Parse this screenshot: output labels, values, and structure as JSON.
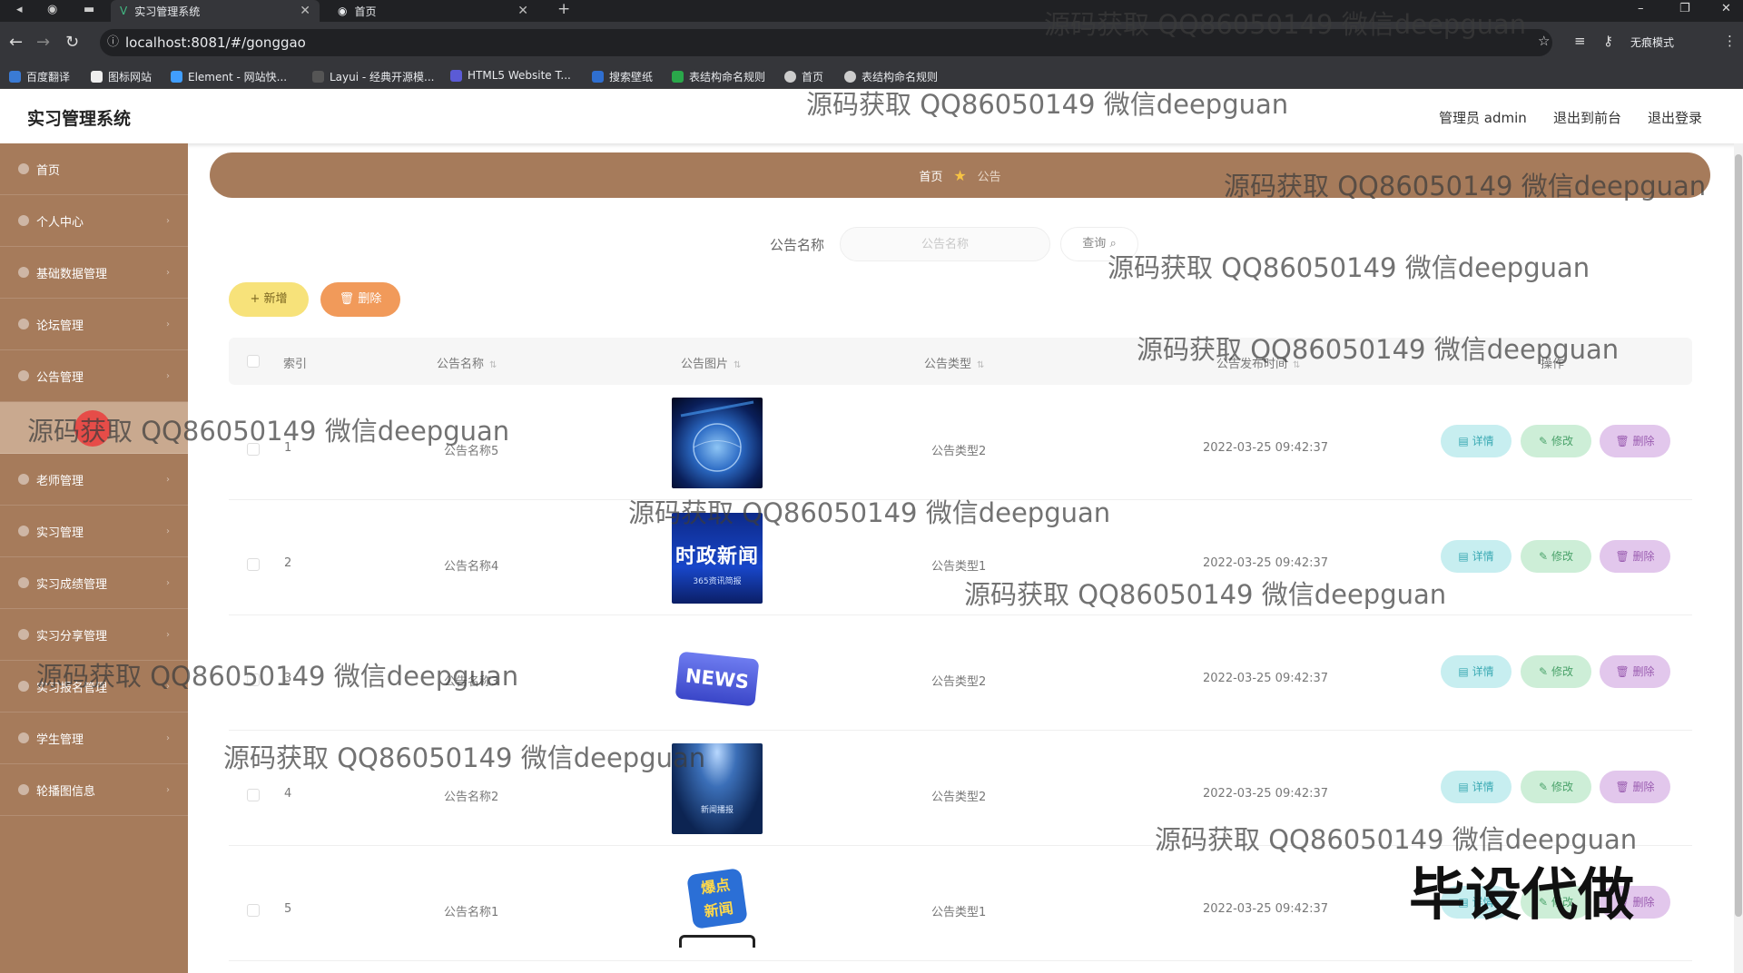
{
  "browser": {
    "tabs": [
      {
        "title": "实习管理系统"
      },
      {
        "title": "首页"
      }
    ],
    "new_tab": "+",
    "url": "localhost:8081/#/gonggao",
    "profile": "无痕模式",
    "bookmarks": [
      "百度翻译",
      "图标网站",
      "Element - 网站快...",
      "Layui - 经典开源模...",
      "HTML5 Website T...",
      "搜索壁纸",
      "表结构命名规则",
      "首页",
      "表结构命名规则"
    ]
  },
  "app": {
    "title": "实习管理系统",
    "user": "管理员 admin",
    "to_front": "退出到前台",
    "logout": "退出登录"
  },
  "sidebar": {
    "items": [
      {
        "label": "首页"
      },
      {
        "label": "个人中心"
      },
      {
        "label": "基础数据管理"
      },
      {
        "label": "论坛管理"
      },
      {
        "label": "公告管理"
      },
      {
        "label": ""
      },
      {
        "label": "老师管理"
      },
      {
        "label": "实习管理"
      },
      {
        "label": "实习成绩管理"
      },
      {
        "label": "实习分享管理"
      },
      {
        "label": "实习报名管理"
      },
      {
        "label": "学生管理"
      },
      {
        "label": "轮播图信息"
      }
    ]
  },
  "breadcrumb": {
    "home": "首页",
    "current": "公告"
  },
  "search": {
    "label": "公告名称",
    "placeholder": "公告名称",
    "button": "查询"
  },
  "toolbar": {
    "add": "+ 新增",
    "delete": "删除"
  },
  "table": {
    "headers": {
      "index": "索引",
      "name": "公告名称",
      "image": "公告图片",
      "type": "公告类型",
      "time": "公告发布时间",
      "ops": "操作"
    },
    "actions": {
      "detail": "详情",
      "edit": "修改",
      "remove": "删除"
    },
    "rows": [
      {
        "index": "1",
        "name": "公告名称5",
        "image": "globe-news-image",
        "type": "公告类型2",
        "time": "2022-03-25 09:42:37"
      },
      {
        "index": "2",
        "name": "公告名称4",
        "image": "shizheng-news-image",
        "type": "公告类型1",
        "time": "2022-03-25 09:42:37"
      },
      {
        "index": "3",
        "name": "公告名称3",
        "image": "news-button-image",
        "type": "公告类型2",
        "time": "2022-03-25 09:42:37"
      },
      {
        "index": "4",
        "name": "公告名称2",
        "image": "stage-news-image",
        "type": "公告类型2",
        "time": "2022-03-25 09:42:37"
      },
      {
        "index": "5",
        "name": "公告名称1",
        "image": "baodian-news-image",
        "type": "公告类型1",
        "time": "2022-03-25 09:42:37"
      }
    ]
  },
  "images": {
    "row2_line1": "时政新闻",
    "row2_line2": "365资讯简报",
    "row3_text": "NEWS",
    "row4_text": "新闻播报",
    "row5_line1": "爆点",
    "row5_line2": "新闻"
  },
  "watermark": {
    "text": "源码获取 QQ86050149 微信deepguan",
    "big": "毕设代做"
  },
  "colors": {
    "sidebar": "#a67b5b",
    "accent_yellow": "#f7e27a",
    "accent_orange": "#f19a5a",
    "detail": "#c7eef0",
    "edit": "#cdeed7",
    "remove": "#e2c7ec"
  }
}
